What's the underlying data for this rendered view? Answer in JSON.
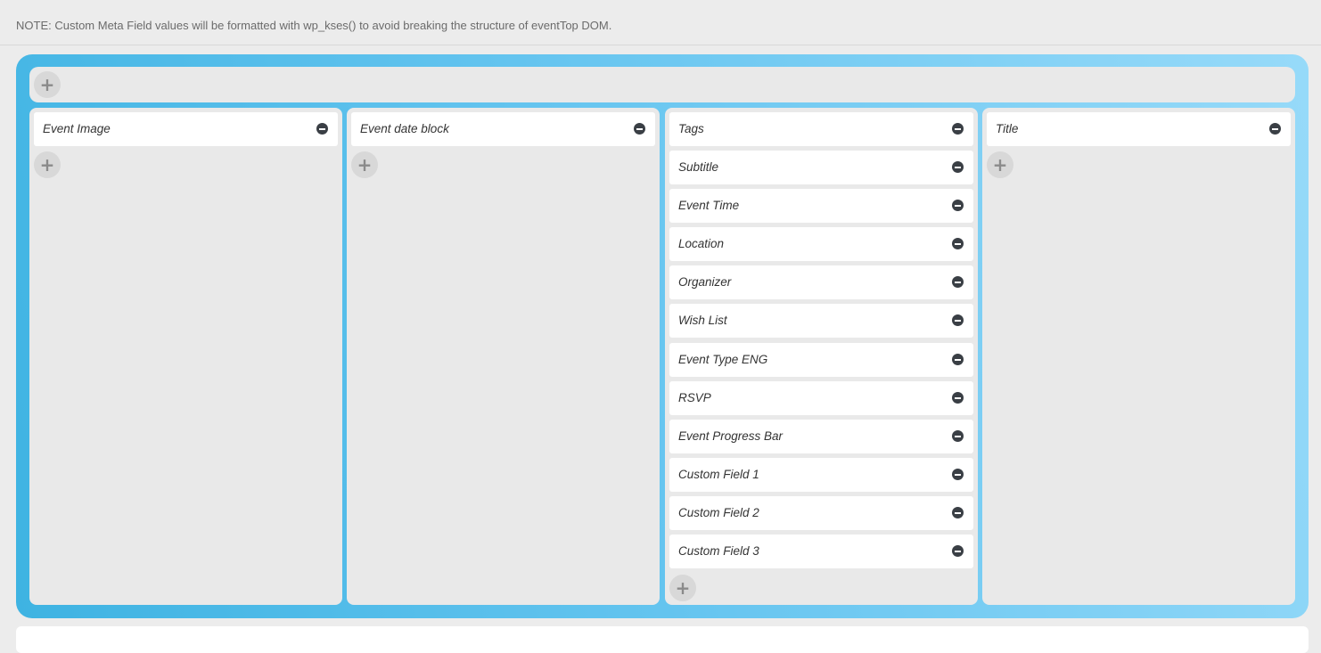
{
  "note": {
    "text": "NOTE: Custom Meta Field values will be formatted with wp_kses() to avoid breaking the structure of eventTop DOM."
  },
  "icons": {
    "add": "plus-icon",
    "remove": "minus-circle-icon"
  },
  "add_symbol": "+",
  "columns": [
    {
      "fields": [
        "Event Image"
      ]
    },
    {
      "fields": [
        "Event date block"
      ]
    },
    {
      "fields": [
        "Tags",
        "Subtitle",
        "Event Time",
        "Location",
        "Organizer",
        "Wish List",
        "Event Type ENG",
        "RSVP",
        "Event Progress Bar",
        "Custom Field 1",
        "Custom Field 2",
        "Custom Field 3"
      ]
    },
    {
      "fields": [
        "Title"
      ]
    }
  ],
  "colors": {
    "panel_start": "#3eb3e2",
    "panel_end": "#97daf9",
    "remove_icon": "#3a3f45"
  }
}
